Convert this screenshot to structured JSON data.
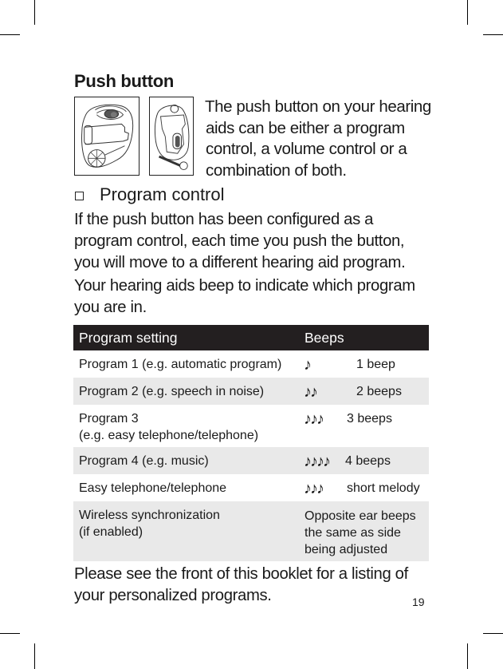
{
  "page": {
    "title": "Push button",
    "intro_lines": [
      "The push button on your hearing",
      "aids can be either a program",
      "control, a volume control or a",
      "combination of both."
    ],
    "figures": [
      {
        "icon": "hearing-aid-front-illustration"
      },
      {
        "icon": "hearing-aid-side-illustration"
      }
    ],
    "subheading": "Program control",
    "paragraph1_lines": [
      "If the push button has been configured as a",
      "program control, each time you push the button,",
      "you will move to a different hearing aid program."
    ],
    "paragraph2_lines": [
      "Your hearing aids beep to indicate which program",
      "you are in."
    ],
    "table": {
      "headers": [
        "Program setting",
        "Beeps"
      ],
      "rows": [
        {
          "setting_lines": [
            "Program 1 (e.g. automatic program)"
          ],
          "notes": "♪",
          "beeps": "1 beep"
        },
        {
          "setting_lines": [
            "Program 2 (e.g. speech in noise)"
          ],
          "notes": "♪♪",
          "beeps": "2 beeps"
        },
        {
          "setting_lines": [
            "Program 3",
            "(e.g. easy telephone/telephone)"
          ],
          "notes": "♪♪♪",
          "beeps": "3 beeps"
        },
        {
          "setting_lines": [
            "Program 4 (e.g. music)"
          ],
          "notes": "♪♪♪♪",
          "beeps": "4 beeps"
        },
        {
          "setting_lines": [
            "Easy telephone/telephone"
          ],
          "notes": "♪♪♪",
          "beeps": "short melody"
        },
        {
          "setting_lines": [
            "Wireless synchronization",
            "(if enabled)"
          ],
          "notes": "",
          "beeps_lines": [
            "Opposite ear beeps",
            "the same as side",
            "being adjusted"
          ]
        }
      ]
    },
    "footer_lines": [
      "Please see the front of this booklet for a listing of",
      "your personalized programs."
    ],
    "page_number": "19"
  },
  "colors": {
    "header_bg": "#231f20",
    "alt_row_bg": "#e9e9e9",
    "text": "#1a1a1a",
    "button_fill": "#555555"
  }
}
